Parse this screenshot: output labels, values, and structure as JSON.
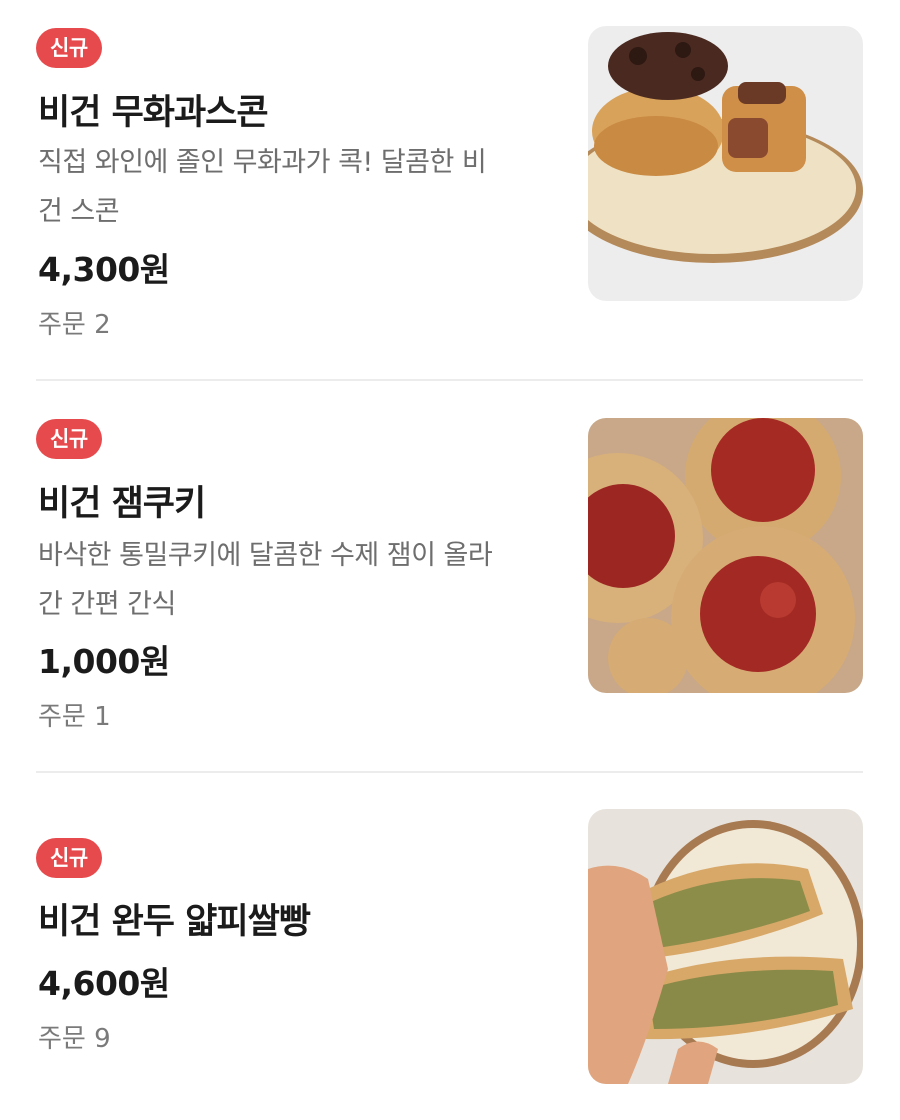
{
  "items": [
    {
      "badge": "신규",
      "name": "비건 무화과스콘",
      "desc_line1": "직접 와인에 졸인 무화과가 콕! 달콤한 비",
      "desc_line2": "건 스콘",
      "price": "4,300원",
      "orders": "주문 2",
      "image_icon": "scone-photo"
    },
    {
      "badge": "신규",
      "name": "비건 잼쿠키",
      "desc_line1": "바삭한 통밀쿠키에 달콤한 수제 잼이 올라",
      "desc_line2": "간 간편 간식",
      "price": "1,000원",
      "orders": "주문 1",
      "image_icon": "jam-cookie-photo"
    },
    {
      "badge": "신규",
      "name": "비건 완두 얇피쌀빵",
      "price": "4,600원",
      "orders": "주문 9",
      "image_icon": "pea-rice-bread-photo"
    }
  ],
  "colors": {
    "badge_bg": "#e64a4d",
    "text_primary": "#1b1b1b",
    "text_secondary": "#6e6e6e",
    "divider": "#ececec"
  }
}
